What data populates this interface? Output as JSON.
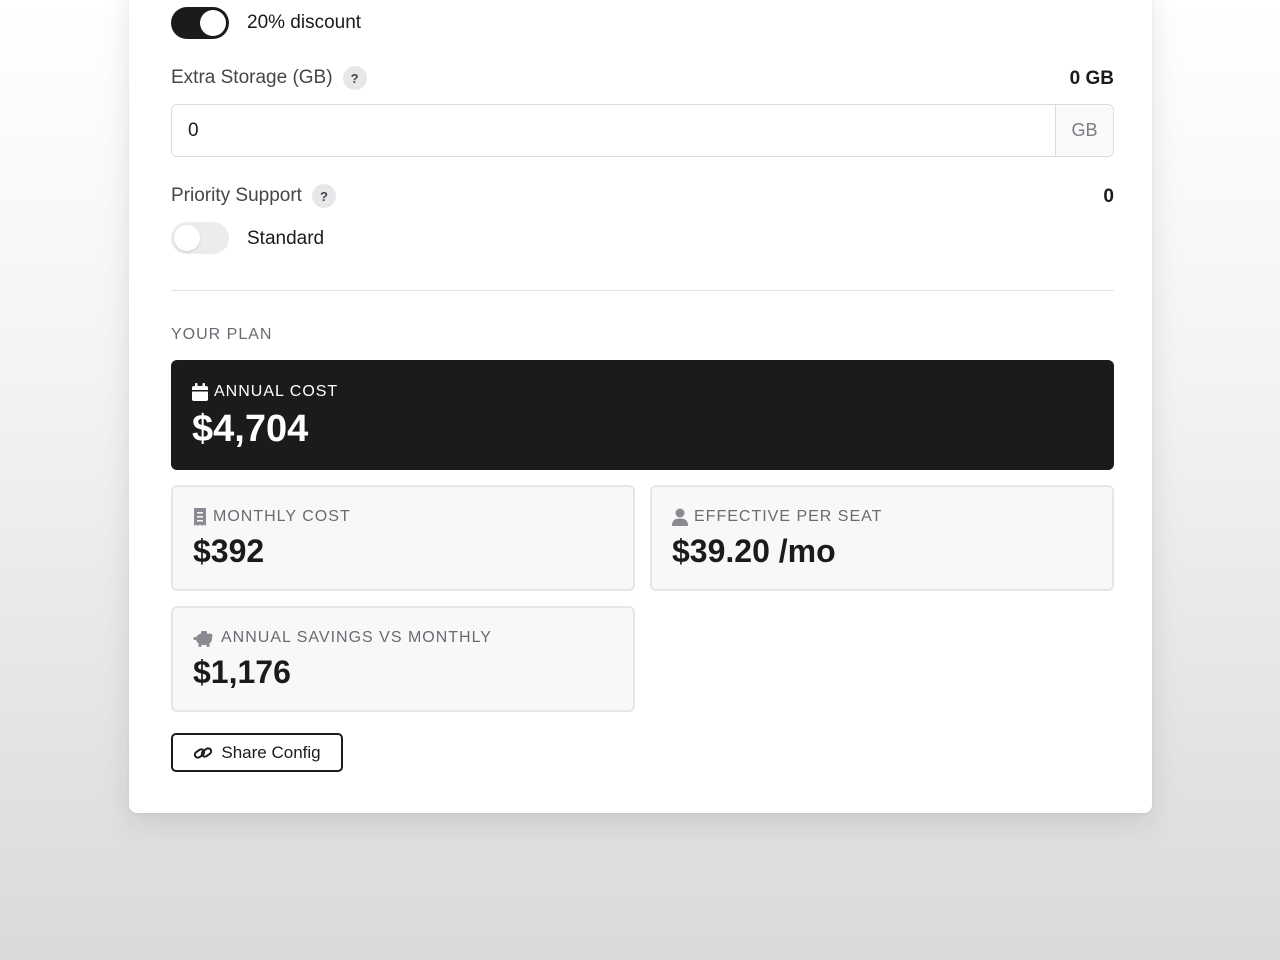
{
  "discount": {
    "label": "20% discount",
    "enabled": true
  },
  "extra_storage": {
    "label": "Extra Storage (GB)",
    "help": "?",
    "value_display": "0 GB",
    "input_value": "0",
    "suffix": "GB"
  },
  "priority_support": {
    "label": "Priority Support",
    "help": "?",
    "value_display": "0",
    "toggle_label": "Standard",
    "enabled": false
  },
  "plan": {
    "heading": "YOUR PLAN",
    "annual_cost": {
      "label": "ANNUAL COST",
      "value": "$4,704",
      "icon": "calendar-icon"
    },
    "monthly_cost": {
      "label": "MONTHLY COST",
      "value": "$392",
      "icon": "receipt-icon"
    },
    "effective_per_seat": {
      "label": "EFFECTIVE PER SEAT",
      "value": "$39.20 /mo",
      "icon": "user-icon"
    },
    "annual_savings": {
      "label": "ANNUAL SAVINGS VS MONTHLY",
      "value": "$1,176",
      "icon": "piggy-bank-icon"
    }
  },
  "share_button": {
    "label": "Share Config",
    "icon": "link-icon"
  },
  "colors": {
    "accent": "#1b1b1d",
    "muted_text": "#6a6a72",
    "card_background": "#f8f8f8",
    "border": "#e6e6e8"
  }
}
